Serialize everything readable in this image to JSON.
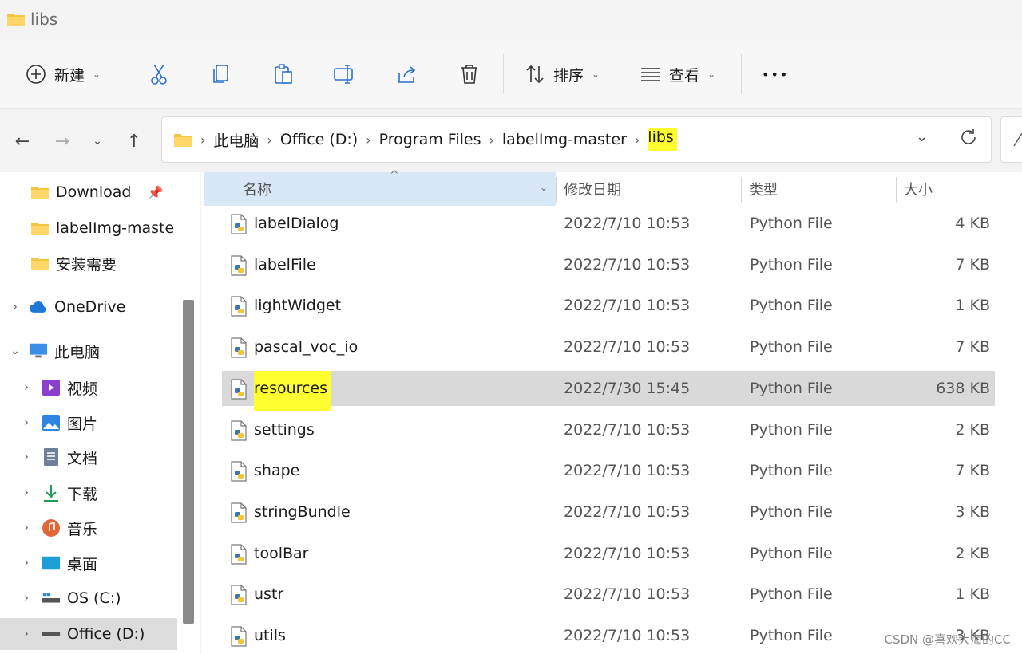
{
  "window": {
    "title": "libs"
  },
  "toolbar": {
    "new_label": "新建",
    "sort_label": "排序",
    "view_label": "查看",
    "more_label": "•••"
  },
  "breadcrumb": [
    "此电脑",
    "Office (D:)",
    "Program Files",
    "labelImg-master",
    "libs"
  ],
  "sidebar": {
    "items": [
      {
        "label": "Download",
        "icon": "folder-icon",
        "pinned": true
      },
      {
        "label": "labelImg-maste",
        "icon": "folder-icon"
      },
      {
        "label": "安装需要",
        "icon": "folder-icon"
      },
      {
        "label": "OneDrive",
        "icon": "cloud-icon"
      },
      {
        "label": "此电脑",
        "icon": "computer-icon"
      },
      {
        "label": "视频",
        "icon": "video-icon"
      },
      {
        "label": "图片",
        "icon": "picture-icon"
      },
      {
        "label": "文档",
        "icon": "document-icon"
      },
      {
        "label": "下载",
        "icon": "download-icon"
      },
      {
        "label": "音乐",
        "icon": "music-icon"
      },
      {
        "label": "桌面",
        "icon": "desktop-icon"
      },
      {
        "label": "OS (C:)",
        "icon": "drive-icon"
      },
      {
        "label": "Office (D:)",
        "icon": "drive-icon",
        "selected": true
      }
    ]
  },
  "columns": {
    "name": "名称",
    "modified": "修改日期",
    "type": "类型",
    "size": "大小"
  },
  "files": [
    {
      "name": "labelDialog",
      "modified": "2022/7/10 10:53",
      "type": "Python File",
      "size": "4 KB"
    },
    {
      "name": "labelFile",
      "modified": "2022/7/10 10:53",
      "type": "Python File",
      "size": "7 KB"
    },
    {
      "name": "lightWidget",
      "modified": "2022/7/10 10:53",
      "type": "Python File",
      "size": "1 KB"
    },
    {
      "name": "pascal_voc_io",
      "modified": "2022/7/10 10:53",
      "type": "Python File",
      "size": "7 KB"
    },
    {
      "name": "resources",
      "modified": "2022/7/30 15:45",
      "type": "Python File",
      "size": "638 KB",
      "selected": true
    },
    {
      "name": "settings",
      "modified": "2022/7/10 10:53",
      "type": "Python File",
      "size": "2 KB"
    },
    {
      "name": "shape",
      "modified": "2022/7/10 10:53",
      "type": "Python File",
      "size": "7 KB"
    },
    {
      "name": "stringBundle",
      "modified": "2022/7/10 10:53",
      "type": "Python File",
      "size": "3 KB"
    },
    {
      "name": "toolBar",
      "modified": "2022/7/10 10:53",
      "type": "Python File",
      "size": "2 KB"
    },
    {
      "name": "ustr",
      "modified": "2022/7/10 10:53",
      "type": "Python File",
      "size": "1 KB"
    },
    {
      "name": "utils",
      "modified": "2022/7/10 10:53",
      "type": "Python File",
      "size": "3 KB"
    }
  ],
  "watermark": "CSDN @喜欢大海的CC",
  "colors": {
    "highlight": "#ffff30",
    "header_selected": "#d9e8f7",
    "row_selected": "#d9d9d9",
    "folder": "#f4c542"
  }
}
